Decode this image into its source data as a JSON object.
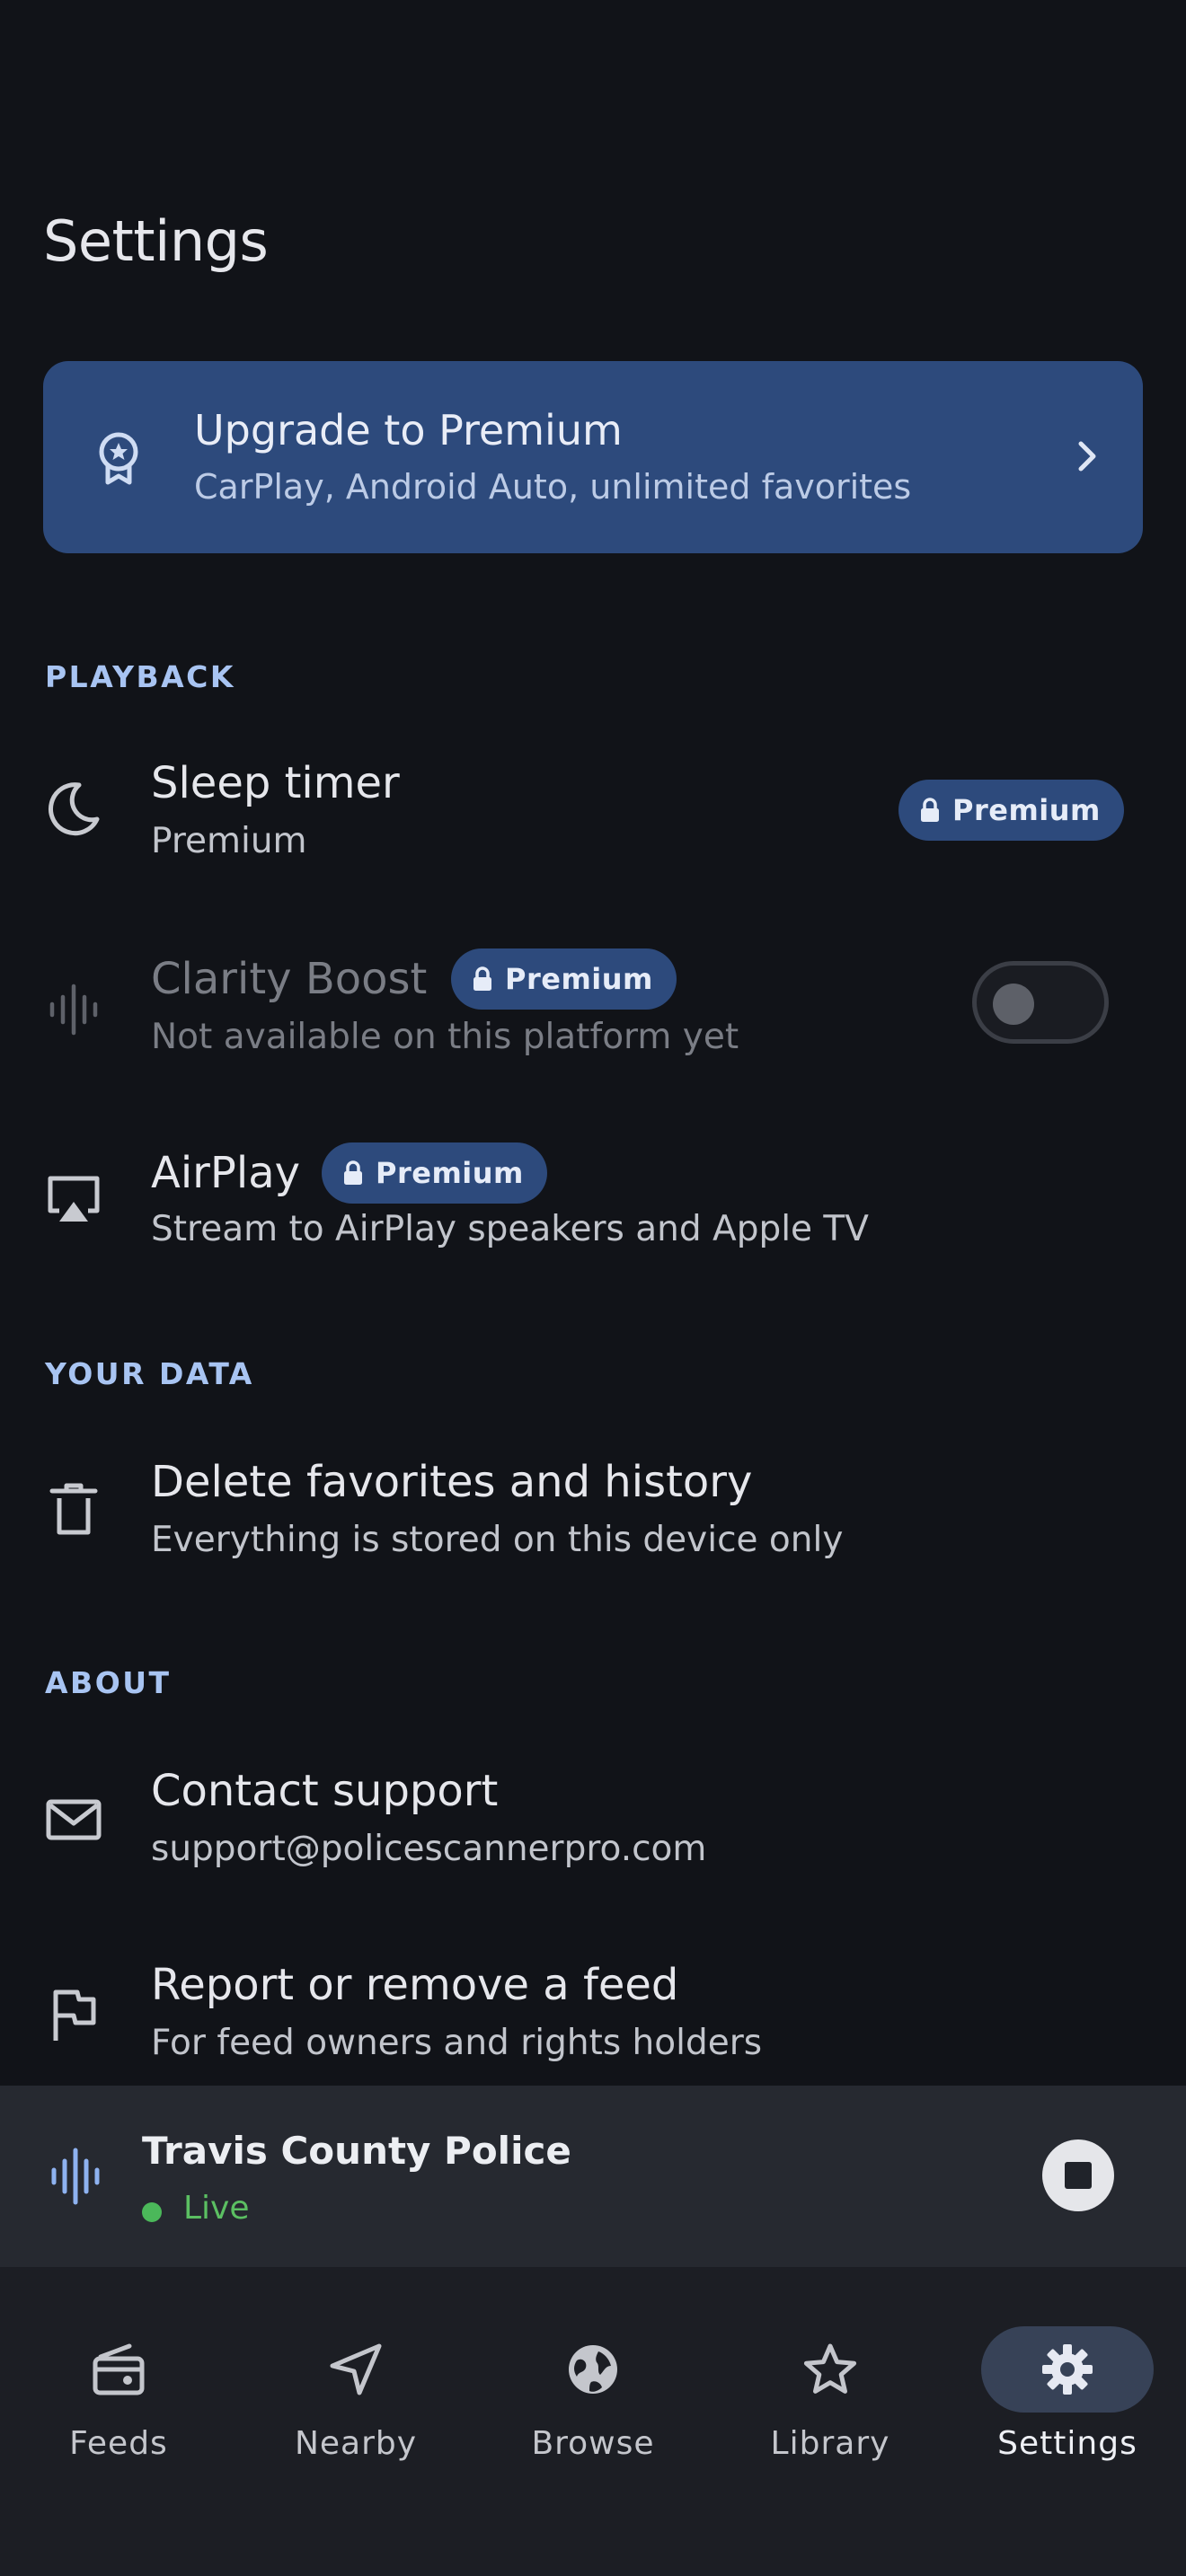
{
  "page": {
    "title": "Settings"
  },
  "premium_card": {
    "title": "Upgrade to Premium",
    "subtitle": "CarPlay, Android Auto, unlimited favorites",
    "icon": "award-ribbon-icon"
  },
  "sections": {
    "playback": "PLAYBACK",
    "your_data": "YOUR DATA",
    "about": "ABOUT"
  },
  "rows": {
    "sleep_timer": {
      "title": "Sleep timer",
      "subtitle": "Premium",
      "badge": "Premium",
      "icon": "moon-icon"
    },
    "clarity_boost": {
      "title": "Clarity Boost",
      "subtitle": "Not available on this platform yet",
      "badge": "Premium",
      "toggle_on": false,
      "icon": "waveform-icon"
    },
    "airplay": {
      "title": "AirPlay",
      "subtitle": "Stream to AirPlay speakers and Apple TV",
      "badge": "Premium",
      "icon": "airplay-icon"
    },
    "delete_data": {
      "title": "Delete favorites and history",
      "subtitle": "Everything is stored on this device only",
      "icon": "trash-icon"
    },
    "contact_support": {
      "title": "Contact support",
      "subtitle": "support@policescannerpro.com",
      "icon": "mail-icon"
    },
    "report_feed": {
      "title": "Report or remove a feed",
      "subtitle": "For feed owners and rights holders",
      "icon": "flag-icon"
    }
  },
  "mini_player": {
    "title": "Travis County Police",
    "status": "Live",
    "live_color": "#4bb85a"
  },
  "tabs": [
    {
      "label": "Feeds",
      "icon": "radio-icon",
      "active": false
    },
    {
      "label": "Nearby",
      "icon": "navigation-icon",
      "active": false
    },
    {
      "label": "Browse",
      "icon": "globe-icon",
      "active": false
    },
    {
      "label": "Library",
      "icon": "star-icon",
      "active": false
    },
    {
      "label": "Settings",
      "icon": "gear-icon",
      "active": true
    }
  ],
  "colors": {
    "background": "#111318",
    "accent": "#2d4a7c",
    "section_header": "#a8c4f2"
  }
}
